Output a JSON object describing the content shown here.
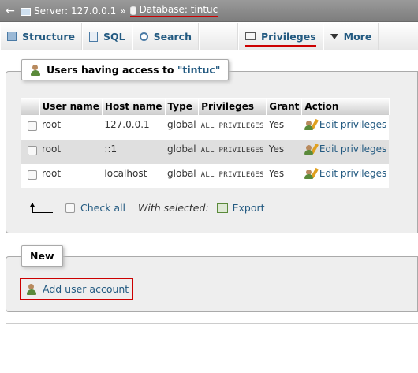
{
  "breadcrumb": {
    "back_glyph": "←",
    "server_icon": "server-icon",
    "server_label": "Server: 127.0.0.1",
    "separator": "»",
    "database_icon": "database-icon",
    "database_label": "Database: tintuc"
  },
  "tabs": [
    {
      "label": "Structure",
      "icon": "structure-icon"
    },
    {
      "label": "SQL",
      "icon": "sql-icon"
    },
    {
      "label": "Search",
      "icon": "search-icon"
    },
    {
      "label": "Privileges",
      "icon": "privileges-icon",
      "active": true
    },
    {
      "label": "More",
      "icon": "chevron-down-icon"
    }
  ],
  "users_panel": {
    "title_prefix": "Users having access to ",
    "db_name": "\"tintuc\"",
    "columns": [
      "User name",
      "Host name",
      "Type",
      "Privileges",
      "Grant",
      "Action"
    ],
    "rows": [
      {
        "user": "root",
        "host": "127.0.0.1",
        "type": "global",
        "privileges": "ALL PRIVILEGES",
        "grant": "Yes",
        "action": "Edit privileges"
      },
      {
        "user": "root",
        "host": "::1",
        "type": "global",
        "privileges": "ALL PRIVILEGES",
        "grant": "Yes",
        "action": "Edit privileges"
      },
      {
        "user": "root",
        "host": "localhost",
        "type": "global",
        "privileges": "ALL PRIVILEGES",
        "grant": "Yes",
        "action": "Edit privileges"
      }
    ],
    "check_all": "Check all",
    "with_selected": "With selected:",
    "export": "Export"
  },
  "new_panel": {
    "title": "New",
    "add_user": "Add user account"
  },
  "colors": {
    "link": "#235a81",
    "highlight": "#cc0000",
    "crumbbar": "#8a8a8a"
  }
}
